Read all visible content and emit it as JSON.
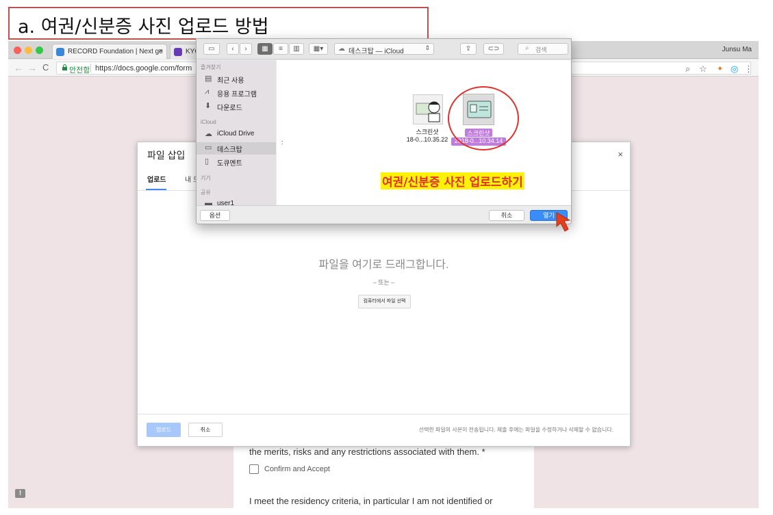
{
  "caption": "a. 여권/신분증 사진 업로드 방법",
  "browser": {
    "tabs": [
      {
        "title": "RECORD Foundation | Next ge"
      },
      {
        "title": "KYC"
      }
    ],
    "user": "Junsu Ma",
    "secure_label": "안전함",
    "url": "https://docs.google.com/form"
  },
  "form": {
    "text1": "the merits, risks and any restrictions associated with them. *",
    "checkbox_label": "Confirm and Accept",
    "text2": "I meet the residency criteria, in particular I am not identified or"
  },
  "insert_dialog": {
    "title": "파일 삽입",
    "tab_upload": "업로드",
    "tab_mydrive": "내 드",
    "drag_text": "파일을 여기로 드래그합니다.",
    "or_text": "– 또는 –",
    "select_button": "컴퓨터에서 파일 선택",
    "upload_button": "업로드",
    "cancel_button": "취소",
    "note": "선택한 파일의 사본이 전송됩니다. 제출 후에는 파일을 수정하거나 삭제할 수 없습니다."
  },
  "mac_dialog": {
    "location": "데스크탑 — iCloud",
    "search_placeholder": "검색",
    "sidebar": {
      "favorites_head": "즐겨찾기",
      "favorites": [
        "최근 사용",
        "응용 프로그램",
        "다운로드"
      ],
      "icloud_head": "iCloud",
      "icloud": [
        "iCloud Drive",
        "데스크탑",
        "도큐멘트"
      ],
      "devices_head": "기기",
      "shared_head": "공유",
      "shared": [
        "user1"
      ]
    },
    "files": [
      {
        "name": "스크린샷",
        "date": "2018-0...10.35.22",
        "date_visible": "18-0...10.35.22",
        "selected": false
      },
      {
        "name": "스크린샷",
        "date": "2018-0...10.34.14",
        "selected": true
      }
    ],
    "annotation": "여권/신분증 사진 업로드하기",
    "options_button": "옵션",
    "cancel_button": "취소",
    "open_button": "열기"
  },
  "colors": {
    "selection": "#c07bdf",
    "open_button": "#3a8cf7",
    "annotation_red": "#e23030",
    "annotation_yellow": "#fff10a"
  },
  "icons": [
    "search-icon",
    "gear-icon",
    "close-icon",
    "lock-icon",
    "cloud-icon",
    "share-icon"
  ]
}
